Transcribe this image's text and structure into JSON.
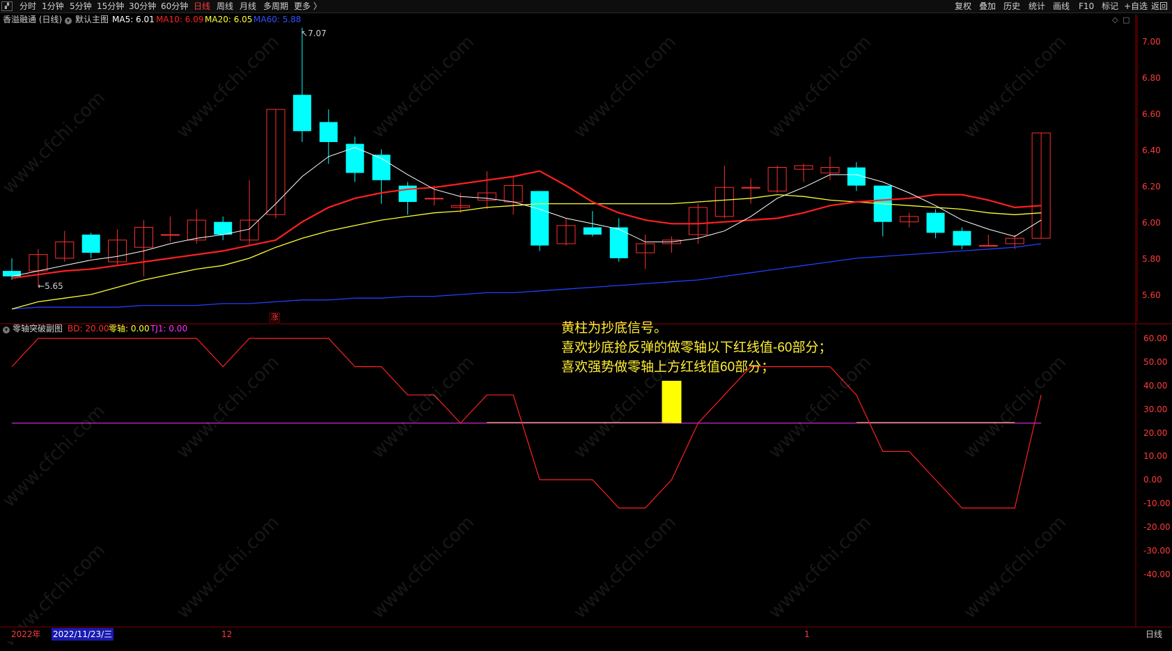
{
  "toolbar": {
    "timeframes": [
      "分时",
      "1分钟",
      "5分钟",
      "15分钟",
      "30分钟",
      "60分钟",
      "日线",
      "周线",
      "月线",
      "多周期",
      "更多 〉"
    ],
    "active_index": 6,
    "right_buttons": [
      "复权",
      "叠加",
      "历史",
      "统计",
      "画线",
      "F10",
      "标记",
      "+自选",
      "返回"
    ]
  },
  "main_chart": {
    "stock_title": "香溢融通 (日线)",
    "template_label": "默认主图",
    "ma": [
      {
        "label": "MA5: 6.01",
        "color": "#ffffff"
      },
      {
        "label": "MA10: 6.09",
        "color": "#ff2020"
      },
      {
        "label": "MA20: 6.05",
        "color": "#ffff33"
      },
      {
        "label": "MA60: 5.88",
        "color": "#2040ff"
      }
    ],
    "y_ticks": [
      "7.00",
      "6.80",
      "6.60",
      "6.40",
      "6.20",
      "6.00",
      "5.80",
      "5.60"
    ],
    "high_marker": "7.07",
    "low_marker": "5.65",
    "limit_up_badge": "涨"
  },
  "indicator": {
    "name": "零轴突破副图",
    "values": [
      {
        "label": "BD: 20.00",
        "color": "#ff3030"
      },
      {
        "label": "零轴: 0.00",
        "color": "#ffff33"
      },
      {
        "label": "TJ1: 0.00",
        "color": "#ff33ff"
      }
    ],
    "y_ticks": [
      "60.00",
      "50.00",
      "40.00",
      "30.00",
      "20.00",
      "10.00",
      "0.00",
      "-10.00",
      "-20.00",
      "-30.00",
      "-40.00"
    ]
  },
  "annotation": {
    "lines": [
      "黄柱为抄底信号。",
      "喜欢抄底抢反弹的做零轴以下红线值-60部分；",
      "喜欢强势做零轴上方红线值60部分；"
    ]
  },
  "bottom_bar": {
    "year_label": "2022年",
    "cursor_date": "2022/11/23/三",
    "month_label_1": "12",
    "month_label_2": "1",
    "period_label": "日线"
  },
  "watermark": "www.cfchi.com",
  "colors": {
    "up": "#ff3030",
    "down": "#00ffff",
    "ma5": "#ffffff",
    "ma10": "#ff2020",
    "ma20": "#ffff33",
    "ma60": "#2040ff",
    "bd": "#ff2020",
    "zero_axis": "#ff33ff",
    "signal": "#ffff00"
  },
  "chart_data": [
    {
      "type": "candlestick",
      "ylim": [
        5.52,
        7.12
      ],
      "candles": [
        {
          "o": 5.73,
          "h": 5.8,
          "l": 5.68,
          "c": 5.7
        },
        {
          "o": 5.73,
          "h": 5.85,
          "l": 5.65,
          "c": 5.82
        },
        {
          "o": 5.8,
          "h": 5.95,
          "l": 5.78,
          "c": 5.89
        },
        {
          "o": 5.93,
          "h": 5.94,
          "l": 5.8,
          "c": 5.83
        },
        {
          "o": 5.78,
          "h": 5.96,
          "l": 5.76,
          "c": 5.9
        },
        {
          "o": 5.86,
          "h": 6.01,
          "l": 5.7,
          "c": 5.97
        },
        {
          "o": 5.93,
          "h": 6.03,
          "l": 5.89,
          "c": 5.93
        },
        {
          "o": 5.9,
          "h": 6.07,
          "l": 5.88,
          "c": 6.01
        },
        {
          "o": 6.0,
          "h": 6.03,
          "l": 5.9,
          "c": 5.93
        },
        {
          "o": 5.9,
          "h": 6.23,
          "l": 5.87,
          "c": 6.01
        },
        {
          "o": 6.04,
          "h": 6.62,
          "l": 6.02,
          "c": 6.62
        },
        {
          "o": 6.7,
          "h": 7.07,
          "l": 6.44,
          "c": 6.5
        },
        {
          "o": 6.55,
          "h": 6.62,
          "l": 6.32,
          "c": 6.44
        },
        {
          "o": 6.43,
          "h": 6.47,
          "l": 6.22,
          "c": 6.27
        },
        {
          "o": 6.37,
          "h": 6.4,
          "l": 6.1,
          "c": 6.23
        },
        {
          "o": 6.2,
          "h": 6.22,
          "l": 6.04,
          "c": 6.11
        },
        {
          "o": 6.13,
          "h": 6.2,
          "l": 6.09,
          "c": 6.13
        },
        {
          "o": 6.08,
          "h": 6.16,
          "l": 6.05,
          "c": 6.09
        },
        {
          "o": 6.12,
          "h": 6.28,
          "l": 6.07,
          "c": 6.16
        },
        {
          "o": 6.11,
          "h": 6.25,
          "l": 6.04,
          "c": 6.2
        },
        {
          "o": 6.17,
          "h": 6.17,
          "l": 5.84,
          "c": 5.87
        },
        {
          "o": 5.88,
          "h": 6.02,
          "l": 5.87,
          "c": 5.98
        },
        {
          "o": 5.97,
          "h": 6.06,
          "l": 5.92,
          "c": 5.93
        },
        {
          "o": 5.97,
          "h": 6.02,
          "l": 5.78,
          "c": 5.8
        },
        {
          "o": 5.83,
          "h": 5.93,
          "l": 5.74,
          "c": 5.88
        },
        {
          "o": 5.88,
          "h": 5.92,
          "l": 5.83,
          "c": 5.9
        },
        {
          "o": 5.93,
          "h": 6.1,
          "l": 5.88,
          "c": 6.08
        },
        {
          "o": 6.03,
          "h": 6.31,
          "l": 6.02,
          "c": 6.19
        },
        {
          "o": 6.19,
          "h": 6.24,
          "l": 6.1,
          "c": 6.19
        },
        {
          "o": 6.17,
          "h": 6.31,
          "l": 6.16,
          "c": 6.3
        },
        {
          "o": 6.29,
          "h": 6.32,
          "l": 6.22,
          "c": 6.31
        },
        {
          "o": 6.27,
          "h": 6.36,
          "l": 6.23,
          "c": 6.3
        },
        {
          "o": 6.3,
          "h": 6.33,
          "l": 6.17,
          "c": 6.2
        },
        {
          "o": 6.2,
          "h": 6.2,
          "l": 5.92,
          "c": 6.0
        },
        {
          "o": 6.0,
          "h": 6.05,
          "l": 5.97,
          "c": 6.03
        },
        {
          "o": 6.05,
          "h": 6.07,
          "l": 5.91,
          "c": 5.94
        },
        {
          "o": 5.95,
          "h": 5.97,
          "l": 5.85,
          "c": 5.87
        },
        {
          "o": 5.87,
          "h": 5.93,
          "l": 5.87,
          "c": 5.87
        },
        {
          "o": 5.88,
          "h": 5.93,
          "l": 5.85,
          "c": 5.91
        },
        {
          "o": 5.91,
          "h": 6.49,
          "l": 5.91,
          "c": 6.49
        }
      ],
      "ma5": [
        5.7,
        5.73,
        5.76,
        5.79,
        5.81,
        5.84,
        5.88,
        5.91,
        5.93,
        5.96,
        6.1,
        6.25,
        6.36,
        6.41,
        6.35,
        6.26,
        6.18,
        6.14,
        6.13,
        6.11,
        6.07,
        6.02,
        5.99,
        5.96,
        5.89,
        5.89,
        5.91,
        5.95,
        6.03,
        6.13,
        6.19,
        6.26,
        6.26,
        6.22,
        6.16,
        6.09,
        6.01,
        5.96,
        5.92,
        6.01
      ],
      "ma10": [
        5.69,
        5.71,
        5.73,
        5.74,
        5.76,
        5.78,
        5.8,
        5.82,
        5.84,
        5.87,
        5.9,
        6.0,
        6.08,
        6.13,
        6.16,
        6.18,
        6.19,
        6.21,
        6.23,
        6.25,
        6.28,
        6.2,
        6.11,
        6.05,
        6.01,
        5.99,
        5.99,
        6.0,
        6.01,
        6.02,
        6.05,
        6.09,
        6.11,
        6.12,
        6.13,
        6.15,
        6.15,
        6.12,
        6.08,
        6.09
      ],
      "ma20": [
        5.52,
        5.56,
        5.58,
        5.6,
        5.64,
        5.68,
        5.71,
        5.74,
        5.76,
        5.8,
        5.86,
        5.91,
        5.95,
        5.98,
        6.01,
        6.03,
        6.05,
        6.06,
        6.08,
        6.09,
        6.1,
        6.1,
        6.1,
        6.1,
        6.1,
        6.1,
        6.11,
        6.12,
        6.13,
        6.15,
        6.14,
        6.12,
        6.11,
        6.1,
        6.09,
        6.08,
        6.07,
        6.05,
        6.04,
        6.05
      ],
      "ma60": [
        5.52,
        5.53,
        5.53,
        5.53,
        5.53,
        5.54,
        5.54,
        5.54,
        5.55,
        5.55,
        5.56,
        5.57,
        5.57,
        5.58,
        5.58,
        5.59,
        5.59,
        5.6,
        5.61,
        5.61,
        5.62,
        5.63,
        5.64,
        5.65,
        5.66,
        5.67,
        5.68,
        5.7,
        5.72,
        5.74,
        5.76,
        5.78,
        5.8,
        5.81,
        5.82,
        5.83,
        5.84,
        5.85,
        5.86,
        5.88
      ]
    },
    {
      "type": "line",
      "ylim": [
        -60,
        60
      ],
      "bd": [
        40,
        60,
        60,
        60,
        60,
        60,
        60,
        60,
        40,
        60,
        60,
        60,
        60,
        40,
        40,
        20,
        20,
        0,
        20,
        20,
        -40,
        -40,
        -40,
        -60,
        -60,
        -40,
        0,
        20,
        40,
        40,
        40,
        40,
        20,
        -20,
        -20,
        -40,
        -60,
        -60,
        -60,
        20
      ],
      "signal": [
        0,
        0,
        0,
        0,
        0,
        0,
        0,
        0,
        0,
        0,
        0,
        0,
        0,
        0,
        0,
        0,
        0,
        0,
        0,
        0,
        0,
        0,
        0,
        0,
        0,
        30,
        0,
        0,
        0,
        0,
        0,
        0,
        0,
        0,
        0,
        0,
        0,
        0,
        0,
        0
      ],
      "zero": 0
    }
  ]
}
